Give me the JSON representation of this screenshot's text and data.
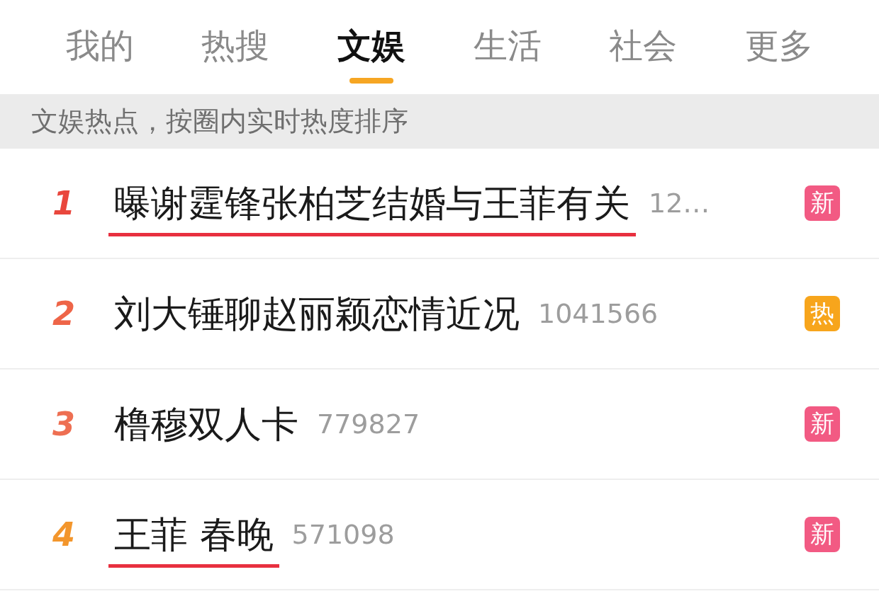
{
  "tabs": [
    {
      "label": "我的",
      "selected": false
    },
    {
      "label": "热搜",
      "selected": false
    },
    {
      "label": "文娱",
      "selected": true
    },
    {
      "label": "生活",
      "selected": false
    },
    {
      "label": "社会",
      "selected": false
    },
    {
      "label": "更多",
      "selected": false
    }
  ],
  "notice": "文娱热点，按圈内实时热度排序",
  "rows": [
    {
      "rank": "1",
      "color": "#e9473d",
      "title": "曝谢霆锋张柏芝结婚与王菲有关",
      "count": "12…",
      "underlined": true,
      "badge": {
        "text": "新",
        "kind": "new"
      }
    },
    {
      "rank": "2",
      "color": "#ee6548",
      "title": "刘大锤聊赵丽颖恋情近况",
      "count": "1041566",
      "underlined": false,
      "badge": {
        "text": "热",
        "kind": "hot"
      }
    },
    {
      "rank": "3",
      "color": "#ee6f52",
      "title": "橹穆双人卡",
      "count": "779827",
      "underlined": false,
      "badge": {
        "text": "新",
        "kind": "new"
      }
    },
    {
      "rank": "4",
      "color": "#f3962c",
      "title": "王菲 春晚",
      "count": "571098",
      "underlined": true,
      "badge": {
        "text": "新",
        "kind": "new"
      }
    }
  ]
}
